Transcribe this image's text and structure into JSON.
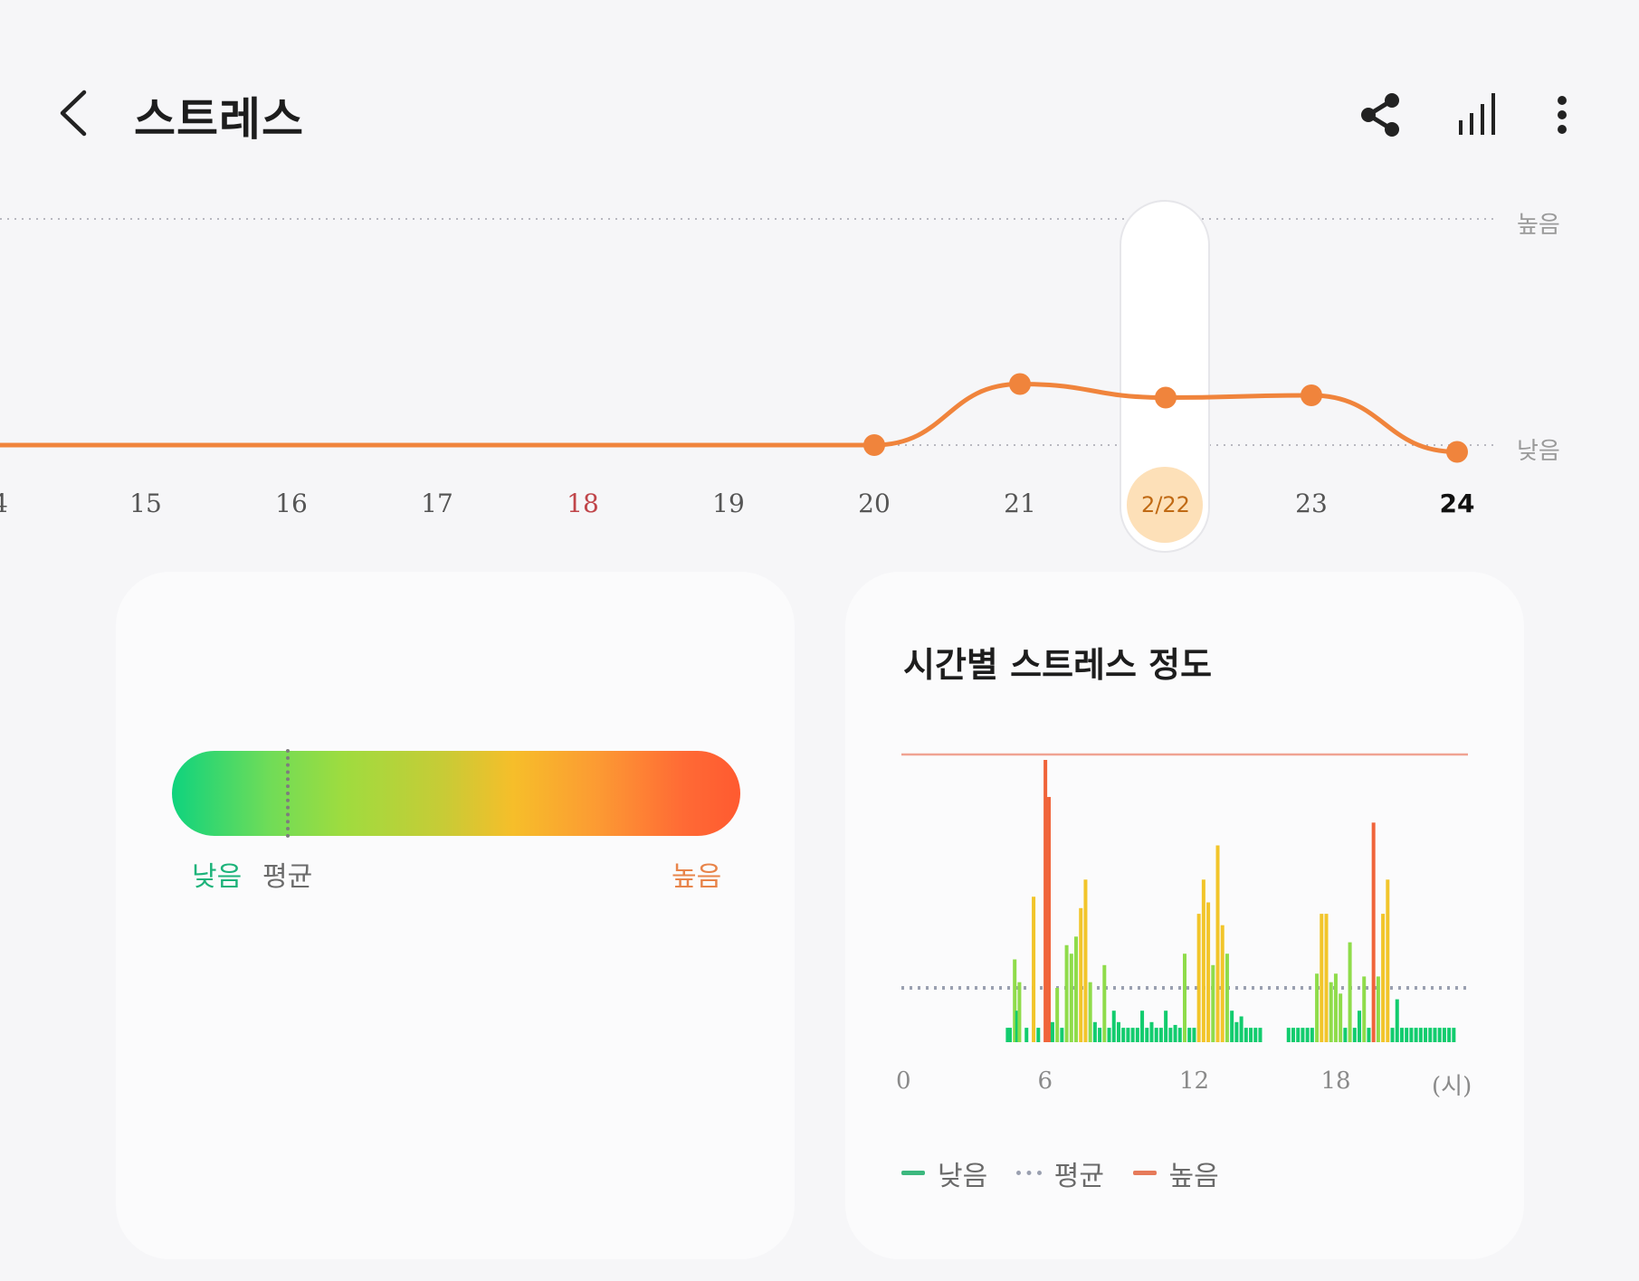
{
  "header": {
    "back_icon": "chevron-left-icon",
    "title": "스트레스",
    "icons": [
      "share-icon",
      "bar-signal-icon",
      "more-vertical-icon"
    ]
  },
  "trend": {
    "level_high": "높음",
    "level_low": "낮음",
    "dates": [
      {
        "label": "4",
        "value": 0
      },
      {
        "label": "15",
        "value": 0
      },
      {
        "label": "16",
        "value": 0
      },
      {
        "label": "17",
        "value": 0
      },
      {
        "label": "18",
        "value": 0,
        "sunday": true
      },
      {
        "label": "19",
        "value": 0
      },
      {
        "label": "20",
        "value": 0
      },
      {
        "label": "21",
        "value": 0.27
      },
      {
        "label": "2/22",
        "value": 0.21,
        "selected": true
      },
      {
        "label": "23",
        "value": 0.22
      },
      {
        "label": "24",
        "value": -0.03,
        "today": true
      }
    ],
    "line_color": "#f0843c",
    "selected_color": "#fde0b8"
  },
  "summary_card": {
    "low_label": "낮음",
    "avg_label": "평균",
    "high_label": "높음",
    "low_color": "#1db37a",
    "high_color": "#e8844a"
  },
  "hourly_card": {
    "title": "시간별 스트레스 정도",
    "x_ticks": [
      "0",
      "6",
      "12",
      "18",
      "(시)"
    ],
    "legend": {
      "low": "낮음",
      "avg": "평균",
      "high": "높음"
    },
    "colors": {
      "low": "#12cc6e",
      "mid": "#8fdc4a",
      "mid2": "#f2c52a",
      "high": "#f0643a",
      "legend_low": "#3cb87e",
      "legend_high": "#e67a5a"
    }
  },
  "chart_data": {
    "type": "bar",
    "title": "시간별 스트레스 정도",
    "xlabel": "(시)",
    "xlim": [
      0,
      24
    ],
    "ylim": [
      0,
      100
    ],
    "average": 20,
    "high_threshold": 100,
    "series": [
      {
        "name": "스트레스",
        "x": [
          4.5,
          4.6,
          4.8,
          4.9,
          5.0,
          5.3,
          5.6,
          5.8,
          6.1,
          6.25,
          6.4,
          6.6,
          6.8,
          7.0,
          7.2,
          7.4,
          7.6,
          7.8,
          8.0,
          8.2,
          8.4,
          8.6,
          8.8,
          9.0,
          9.2,
          9.4,
          9.6,
          9.8,
          10.0,
          10.2,
          10.4,
          10.6,
          10.8,
          11.0,
          11.2,
          11.4,
          11.6,
          11.8,
          12.0,
          12.2,
          12.4,
          12.6,
          12.8,
          13.0,
          13.2,
          13.4,
          13.6,
          13.8,
          14.0,
          14.2,
          14.4,
          14.6,
          14.8,
          15.0,
          15.2,
          16.4,
          16.6,
          16.8,
          17.0,
          17.2,
          17.4,
          17.6,
          17.8,
          18.0,
          18.2,
          18.4,
          18.6,
          18.8,
          19.0,
          19.2,
          19.4,
          19.6,
          19.8,
          20.0,
          20.2,
          20.4,
          20.6,
          20.8,
          21.0,
          21.2,
          21.4,
          21.6,
          21.8,
          22.0,
          22.2,
          22.4,
          22.6,
          22.8,
          23.0,
          23.2,
          23.4
        ],
        "values": [
          6,
          6,
          30,
          12,
          22,
          6,
          52,
          6,
          100,
          87,
          8,
          20,
          6,
          35,
          32,
          38,
          48,
          58,
          22,
          8,
          6,
          28,
          6,
          12,
          8,
          6,
          6,
          6,
          6,
          12,
          6,
          8,
          6,
          6,
          12,
          6,
          7,
          6,
          32,
          6,
          6,
          46,
          58,
          50,
          28,
          70,
          42,
          32,
          12,
          8,
          10,
          6,
          6,
          6,
          6,
          6,
          6,
          6,
          6,
          6,
          6,
          25,
          46,
          46,
          22,
          25,
          18,
          6,
          36,
          6,
          12,
          24,
          6,
          78,
          24,
          46,
          58,
          6,
          16,
          6,
          6,
          6,
          6,
          6,
          6,
          6,
          6,
          6,
          6,
          6,
          6
        ]
      }
    ]
  }
}
